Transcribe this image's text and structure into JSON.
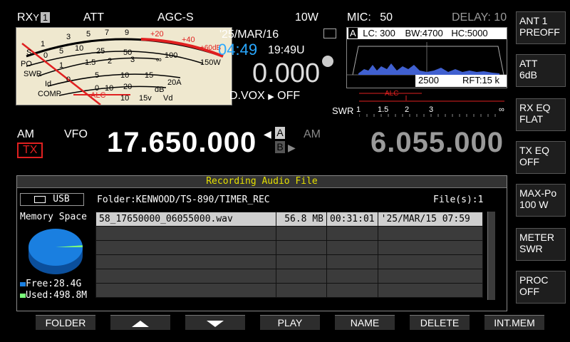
{
  "status": {
    "rx_label": "RX",
    "rx_num": "1",
    "att": "ATT",
    "agc": "AGC-S",
    "power": "10W",
    "mic_label": "MIC:",
    "mic_value": "50",
    "delay": "DELAY: 10"
  },
  "meter": {
    "s_scale": [
      "1",
      "3",
      "5",
      "7",
      "9",
      "+20",
      "+40",
      "+60dB"
    ],
    "po_scale": [
      "0",
      "5",
      "10",
      "25",
      "50",
      "100",
      "150W"
    ],
    "swr_scale": [
      "1",
      "1.5",
      "2",
      "3",
      "∞"
    ],
    "id_scale": [
      "0",
      "5",
      "10",
      "15",
      "20A"
    ],
    "comp_scale": [
      "0",
      "10",
      "20",
      "dB"
    ],
    "vd_scale": [
      "10",
      "15v",
      "Vd"
    ],
    "labels": [
      "S",
      "PO",
      "SWR",
      "Id",
      "COMP"
    ],
    "alc": "ALC"
  },
  "clock": {
    "date": "'25/MAR/16",
    "local_time": "04:49",
    "utc_time": "19:49U",
    "offset": "0.000",
    "dvox": "D.VOX",
    "dvox_state": "OFF"
  },
  "scope": {
    "vfo": "A",
    "lc": "LC: 300",
    "bw": "BW:4700",
    "hc": "HC:5000",
    "freq": "2500",
    "rft": "RFT:15 k"
  },
  "swr_bar": {
    "alc": "ALC",
    "swr": "SWR",
    "ticks": [
      "1",
      "1.5",
      "2",
      "3",
      "∞"
    ]
  },
  "main": {
    "mode_a": "AM",
    "tx_badge": "TX",
    "vfo_label": "VFO",
    "freq_a": "17.650.000",
    "vfo_a": "A",
    "vfo_b": "B",
    "mode_b": "AM",
    "freq_b": "6.055.000"
  },
  "right_keys": [
    {
      "line1": "ANT 1",
      "line2": "PREOFF"
    },
    {
      "line1": "ATT",
      "line2": "6dB"
    },
    {
      "line1": "RX EQ",
      "line2": "FLAT"
    },
    {
      "line1": "TX EQ",
      "line2": "OFF"
    },
    {
      "line1": "MAX-Po",
      "line2": "100 W"
    },
    {
      "line1": "METER",
      "line2": "SWR"
    },
    {
      "line1": "PROC",
      "line2": "OFF"
    }
  ],
  "panel": {
    "title": "Recording Audio File",
    "usb": "USB",
    "folder": "Folder:KENWOOD/TS-890/TIMER_REC",
    "file_count": "File(s):1",
    "memory_label": "Memory Space",
    "free": "Free:28.4G",
    "used": "Used:498.8M",
    "free_fraction": 0.983,
    "files": [
      {
        "name": "58_17650000_06055000.wav",
        "size": "56.8 MB",
        "duration": "00:31:01",
        "date": "'25/MAR/15 07:59"
      }
    ]
  },
  "softkeys": [
    "FOLDER",
    "",
    "",
    "PLAY",
    "NAME",
    "DELETE",
    "INT.MEM"
  ],
  "colors": {
    "time_blue": "#29a8ff",
    "tx_red": "#e02020",
    "title_yellow": "#e6e000",
    "free_blue": "#1a7fe0",
    "used_green": "#7cff7c"
  }
}
